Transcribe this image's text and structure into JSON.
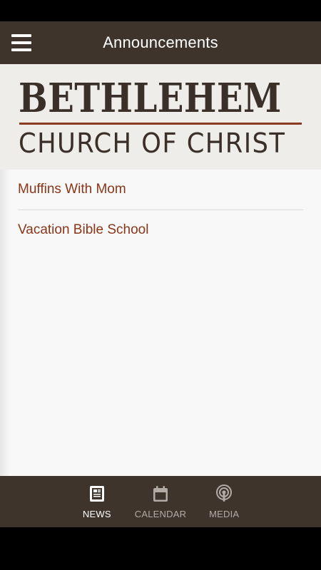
{
  "header": {
    "title": "Announcements",
    "menu_icon": "hamburger-menu-icon"
  },
  "logo": {
    "line1": "BETHLEHEM",
    "line2": "CHURCH OF CHRIST",
    "rule_color": "#8a3a1e"
  },
  "announcements": [
    {
      "title": "Muffins With Mom"
    },
    {
      "title": "Vacation Bible School"
    }
  ],
  "bottom_nav": {
    "tabs": [
      {
        "label": "NEWS",
        "icon": "newspaper-icon",
        "active": true
      },
      {
        "label": "CALENDAR",
        "icon": "calendar-icon",
        "active": false
      },
      {
        "label": "MEDIA",
        "icon": "podcast-icon",
        "active": false
      }
    ]
  },
  "colors": {
    "bar_background": "#3e342c",
    "link": "#8a3518",
    "content_background": "#f8f8f8"
  }
}
